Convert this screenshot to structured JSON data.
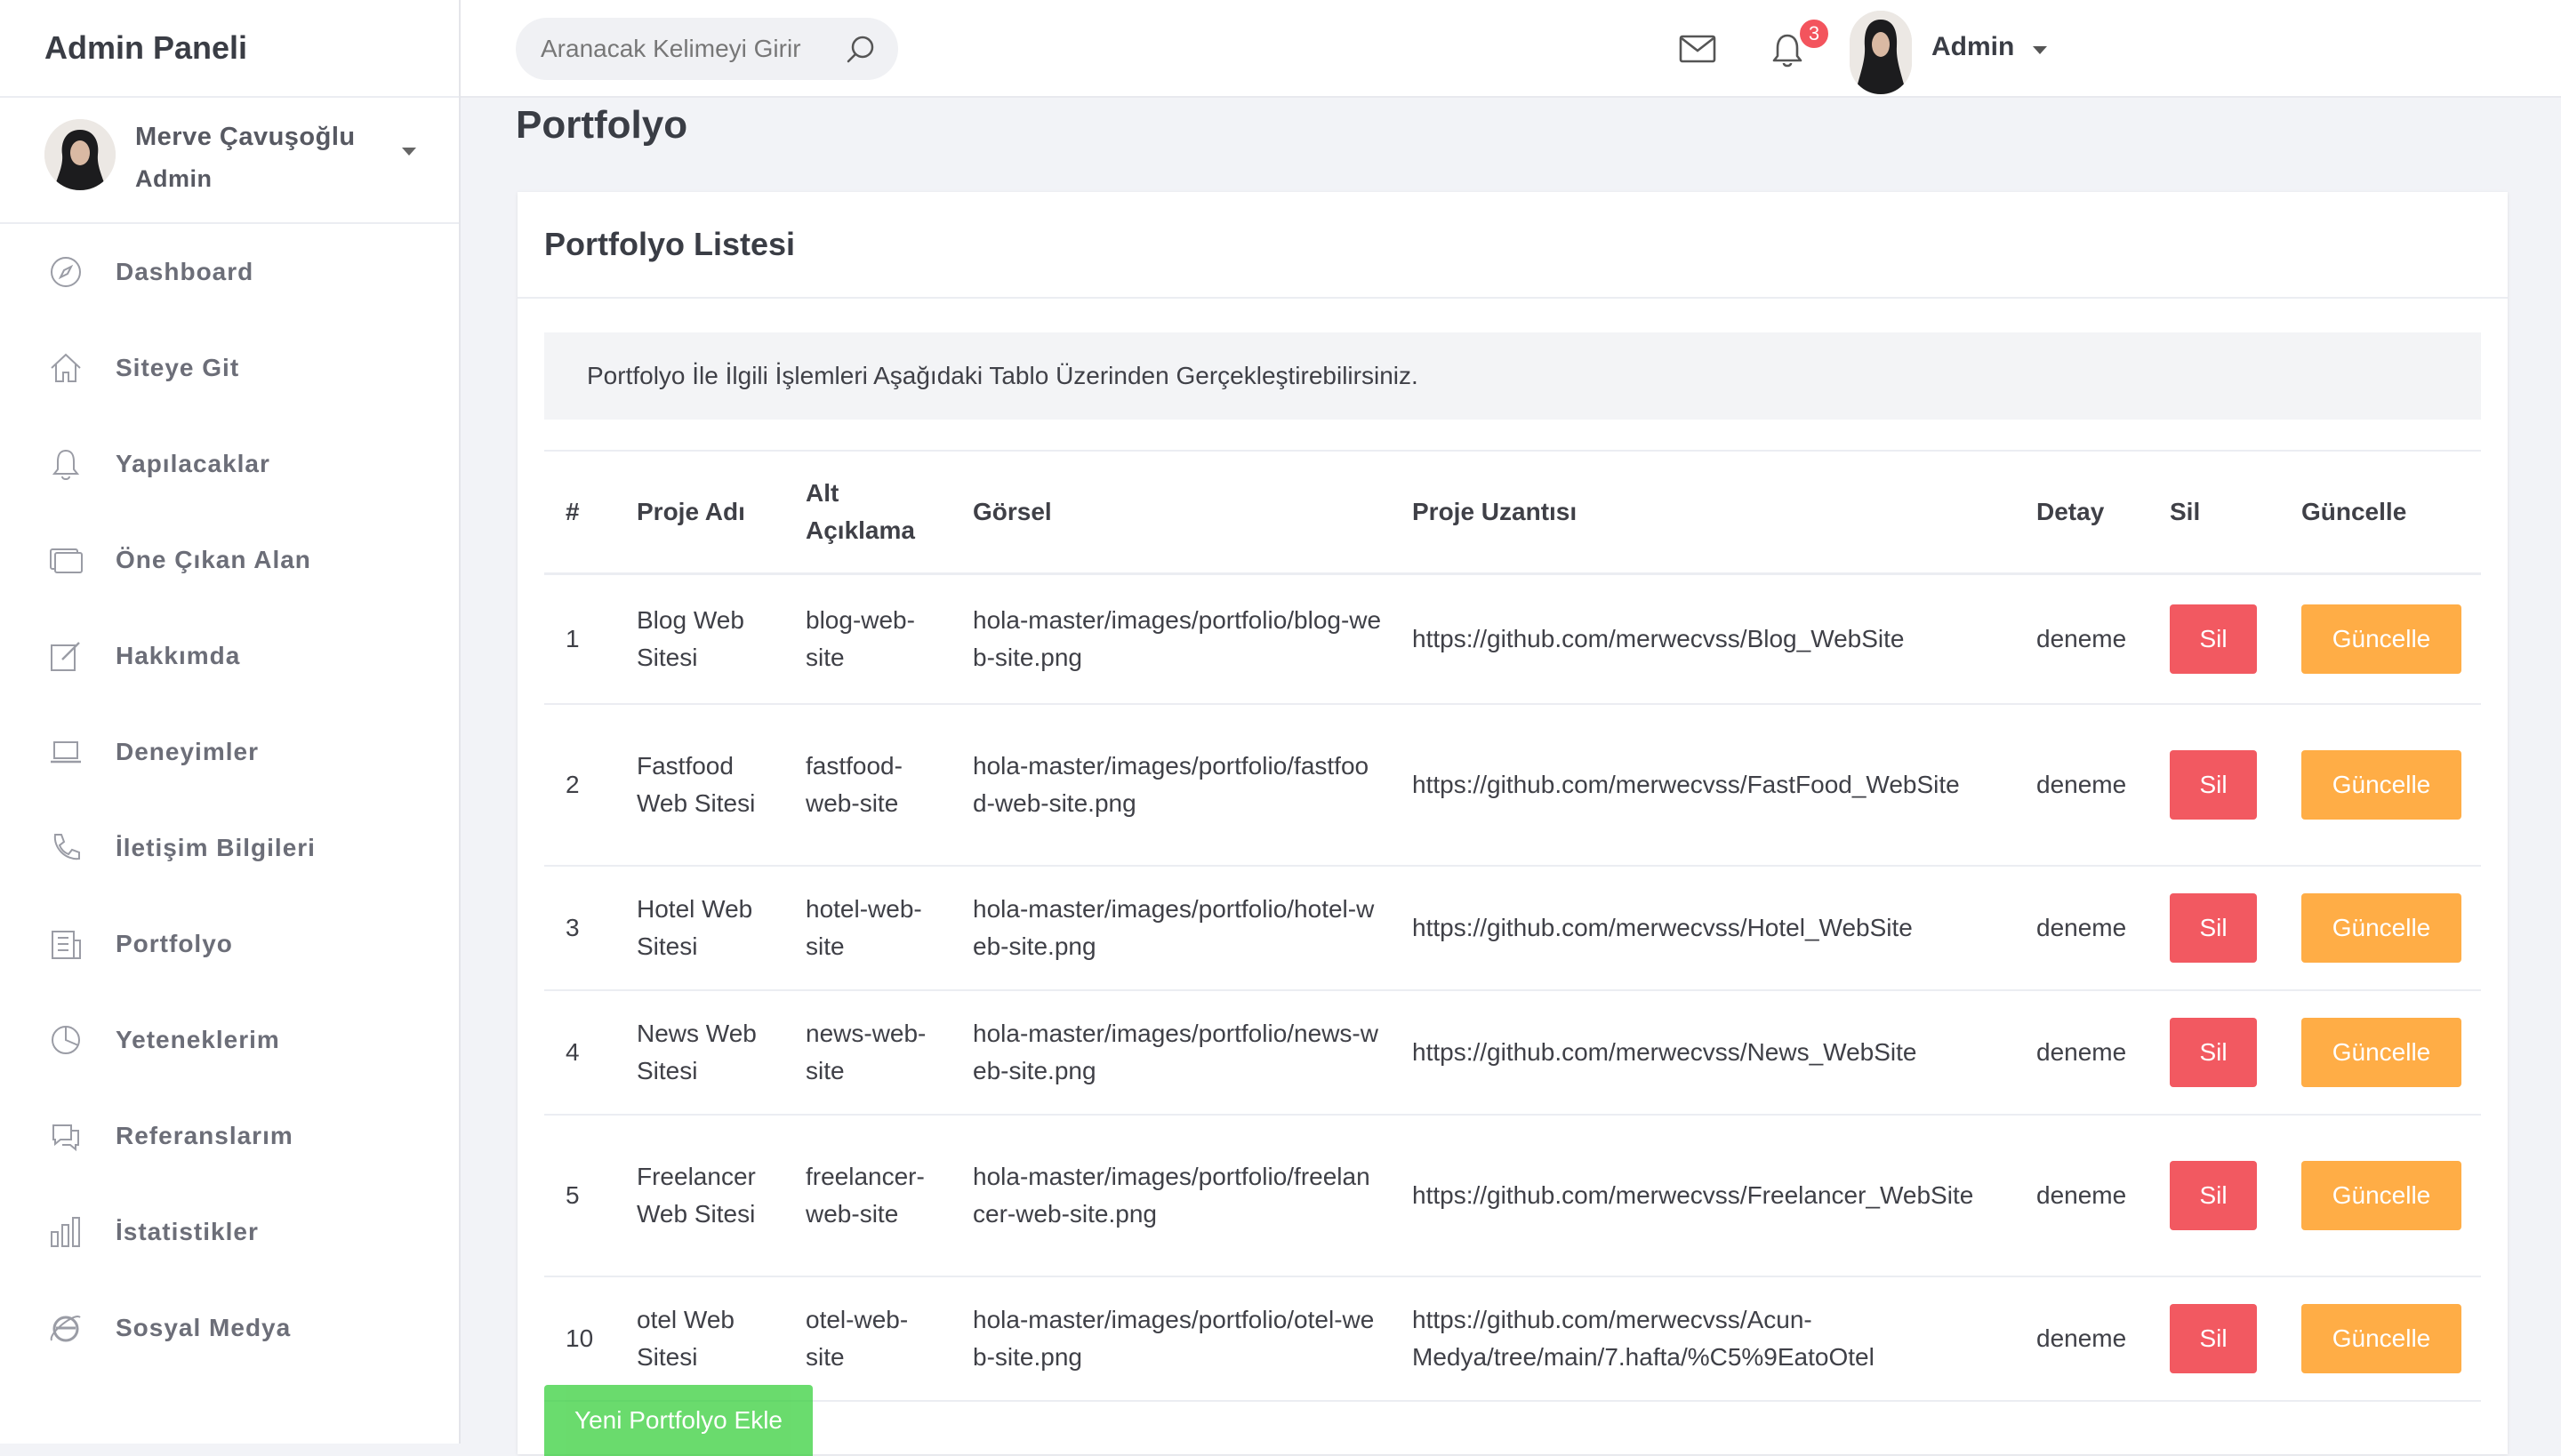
{
  "sidebar": {
    "brand": "Admin Paneli",
    "user": {
      "name": "Merve Çavuşoğlu",
      "role": "Admin"
    },
    "items": [
      {
        "label": "Dashboard",
        "icon": "compass-icon"
      },
      {
        "label": "Siteye Git",
        "icon": "home-icon"
      },
      {
        "label": "Yapılacaklar",
        "icon": "bell-icon"
      },
      {
        "label": "Öne Çıkan Alan",
        "icon": "monitor-icon"
      },
      {
        "label": "Hakkımda",
        "icon": "edit-icon"
      },
      {
        "label": "Deneyimler",
        "icon": "laptop-icon"
      },
      {
        "label": "İletişim Bilgileri",
        "icon": "phone-icon"
      },
      {
        "label": "Portfolyo",
        "icon": "building-icon"
      },
      {
        "label": "Yeteneklerim",
        "icon": "pie-chart-icon"
      },
      {
        "label": "Referanslarım",
        "icon": "chat-icon"
      },
      {
        "label": "İstatistikler",
        "icon": "bar-chart-icon"
      },
      {
        "label": "Sosyal Medya",
        "icon": "ie-icon"
      }
    ]
  },
  "topbar": {
    "search_placeholder": "Aranacak Kelimeyi Girir",
    "notification_count": "3",
    "user_label": "Admin"
  },
  "page": {
    "title": "Portfolyo",
    "card_title": "Portfolyo Listesi",
    "info": "Portfolyo İle İlgili İşlemleri Aşağıdaki Tablo Üzerinden Gerçekleştirebilirsiniz.",
    "add_button": "Yeni Portfolyo Ekle"
  },
  "table": {
    "headers": [
      "#",
      "Proje Adı",
      "Alt Açıklama",
      "Görsel",
      "Proje Uzantısı",
      "Detay",
      "Sil",
      "Güncelle"
    ],
    "delete_label": "Sil",
    "update_label": "Güncelle",
    "rows": [
      {
        "id": "1",
        "name": "Blog Web Sitesi",
        "alt": "blog-web-site",
        "image": "hola-master/images/portfolio/blog-web-site.png",
        "url": "https://github.com/merwecvss/Blog_WebSite",
        "detail": "deneme"
      },
      {
        "id": "2",
        "name": "Fastfood Web Sitesi",
        "alt": "fastfood-web-site",
        "image": "hola-master/images/portfolio/fastfood-web-site.png",
        "url": "https://github.com/merwecvss/FastFood_WebSite",
        "detail": "deneme"
      },
      {
        "id": "3",
        "name": "Hotel Web Sitesi",
        "alt": "hotel-web-site",
        "image": "hola-master/images/portfolio/hotel-web-site.png",
        "url": "https://github.com/merwecvss/Hotel_WebSite",
        "detail": "deneme"
      },
      {
        "id": "4",
        "name": "News Web Sitesi",
        "alt": "news-web-site",
        "image": "hola-master/images/portfolio/news-web-site.png",
        "url": "https://github.com/merwecvss/News_WebSite",
        "detail": "deneme"
      },
      {
        "id": "5",
        "name": "Freelancer Web Sitesi",
        "alt": "freelancer-web-site",
        "image": "hola-master/images/portfolio/freelancer-web-site.png",
        "url": "https://github.com/merwecvss/Freelancer_WebSite",
        "detail": "deneme"
      },
      {
        "id": "10",
        "name": "otel Web Sitesi",
        "alt": "otel-web-site",
        "image": "hola-master/images/portfolio/otel-web-site.png",
        "url": "https://github.com/merwecvss/Acun-Medya/tree/main/7.hafta/%C5%9EatoOtel",
        "detail": "deneme"
      }
    ]
  },
  "colors": {
    "delete": "#f25961",
    "update": "#ffad46",
    "add": "#31ce36",
    "badge": "#f3545d"
  }
}
